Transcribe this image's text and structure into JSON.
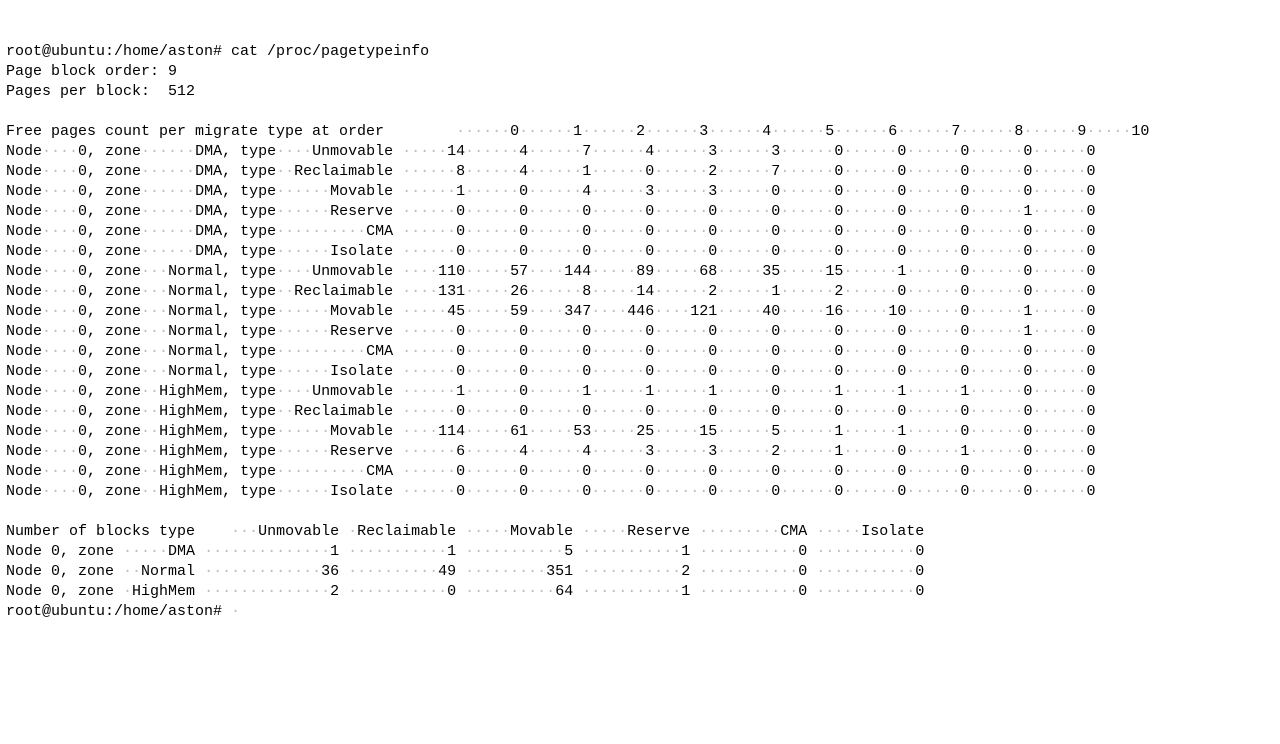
{
  "prompt": "root@ubuntu:/home/aston# ",
  "command": "cat /proc/pagetypeinfo",
  "page_block_order_label": "Page block order:",
  "page_block_order_value": 9,
  "pages_per_block_label": "Pages per block:",
  "pages_per_block_value": 512,
  "free_pages_header_label": "Free pages count per migrate type at order",
  "orders": [
    0,
    1,
    2,
    3,
    4,
    5,
    6,
    7,
    8,
    9,
    10
  ],
  "free_pages_rows": [
    {
      "node": 0,
      "zone": "DMA",
      "type": "Unmovable",
      "counts": [
        14,
        4,
        7,
        4,
        3,
        3,
        0,
        0,
        0,
        0,
        0
      ]
    },
    {
      "node": 0,
      "zone": "DMA",
      "type": "Reclaimable",
      "counts": [
        8,
        4,
        1,
        0,
        2,
        7,
        0,
        0,
        0,
        0,
        0
      ]
    },
    {
      "node": 0,
      "zone": "DMA",
      "type": "Movable",
      "counts": [
        1,
        0,
        4,
        3,
        3,
        0,
        0,
        0,
        0,
        0,
        0
      ]
    },
    {
      "node": 0,
      "zone": "DMA",
      "type": "Reserve",
      "counts": [
        0,
        0,
        0,
        0,
        0,
        0,
        0,
        0,
        0,
        1,
        0
      ]
    },
    {
      "node": 0,
      "zone": "DMA",
      "type": "CMA",
      "counts": [
        0,
        0,
        0,
        0,
        0,
        0,
        0,
        0,
        0,
        0,
        0
      ]
    },
    {
      "node": 0,
      "zone": "DMA",
      "type": "Isolate",
      "counts": [
        0,
        0,
        0,
        0,
        0,
        0,
        0,
        0,
        0,
        0,
        0
      ]
    },
    {
      "node": 0,
      "zone": "Normal",
      "type": "Unmovable",
      "counts": [
        110,
        57,
        144,
        89,
        68,
        35,
        15,
        1,
        0,
        0,
        0
      ]
    },
    {
      "node": 0,
      "zone": "Normal",
      "type": "Reclaimable",
      "counts": [
        131,
        26,
        8,
        14,
        2,
        1,
        2,
        0,
        0,
        0,
        0
      ]
    },
    {
      "node": 0,
      "zone": "Normal",
      "type": "Movable",
      "counts": [
        45,
        59,
        347,
        446,
        121,
        40,
        16,
        10,
        0,
        1,
        0
      ]
    },
    {
      "node": 0,
      "zone": "Normal",
      "type": "Reserve",
      "counts": [
        0,
        0,
        0,
        0,
        0,
        0,
        0,
        0,
        0,
        1,
        0
      ]
    },
    {
      "node": 0,
      "zone": "Normal",
      "type": "CMA",
      "counts": [
        0,
        0,
        0,
        0,
        0,
        0,
        0,
        0,
        0,
        0,
        0
      ]
    },
    {
      "node": 0,
      "zone": "Normal",
      "type": "Isolate",
      "counts": [
        0,
        0,
        0,
        0,
        0,
        0,
        0,
        0,
        0,
        0,
        0
      ]
    },
    {
      "node": 0,
      "zone": "HighMem",
      "type": "Unmovable",
      "counts": [
        1,
        0,
        1,
        1,
        1,
        0,
        1,
        1,
        1,
        0,
        0
      ]
    },
    {
      "node": 0,
      "zone": "HighMem",
      "type": "Reclaimable",
      "counts": [
        0,
        0,
        0,
        0,
        0,
        0,
        0,
        0,
        0,
        0,
        0
      ]
    },
    {
      "node": 0,
      "zone": "HighMem",
      "type": "Movable",
      "counts": [
        114,
        61,
        53,
        25,
        15,
        5,
        1,
        1,
        0,
        0,
        0
      ]
    },
    {
      "node": 0,
      "zone": "HighMem",
      "type": "Reserve",
      "counts": [
        6,
        4,
        4,
        3,
        3,
        2,
        1,
        0,
        1,
        0,
        0
      ]
    },
    {
      "node": 0,
      "zone": "HighMem",
      "type": "CMA",
      "counts": [
        0,
        0,
        0,
        0,
        0,
        0,
        0,
        0,
        0,
        0,
        0
      ]
    },
    {
      "node": 0,
      "zone": "HighMem",
      "type": "Isolate",
      "counts": [
        0,
        0,
        0,
        0,
        0,
        0,
        0,
        0,
        0,
        0,
        0
      ]
    }
  ],
  "blocks_header_label": "Number of blocks type",
  "block_types": [
    "Unmovable",
    "Reclaimable",
    "Movable",
    "Reserve",
    "CMA",
    "Isolate"
  ],
  "blocks_rows": [
    {
      "node": 0,
      "zone": "DMA",
      "counts": [
        1,
        1,
        5,
        1,
        0,
        0
      ]
    },
    {
      "node": 0,
      "zone": "Normal",
      "counts": [
        36,
        49,
        351,
        2,
        0,
        0
      ]
    },
    {
      "node": 0,
      "zone": "HighMem",
      "counts": [
        2,
        0,
        64,
        1,
        0,
        0
      ]
    }
  ],
  "chart_data": {
    "type": "table",
    "title": "/proc/pagetypeinfo",
    "tables": [
      {
        "name": "Free pages count per migrate type at order",
        "columns": [
          "Node",
          "Zone",
          "Type",
          "0",
          "1",
          "2",
          "3",
          "4",
          "5",
          "6",
          "7",
          "8",
          "9",
          "10"
        ],
        "rows": [
          [
            0,
            "DMA",
            "Unmovable",
            14,
            4,
            7,
            4,
            3,
            3,
            0,
            0,
            0,
            0,
            0
          ],
          [
            0,
            "DMA",
            "Reclaimable",
            8,
            4,
            1,
            0,
            2,
            7,
            0,
            0,
            0,
            0,
            0
          ],
          [
            0,
            "DMA",
            "Movable",
            1,
            0,
            4,
            3,
            3,
            0,
            0,
            0,
            0,
            0,
            0
          ],
          [
            0,
            "DMA",
            "Reserve",
            0,
            0,
            0,
            0,
            0,
            0,
            0,
            0,
            0,
            1,
            0
          ],
          [
            0,
            "DMA",
            "CMA",
            0,
            0,
            0,
            0,
            0,
            0,
            0,
            0,
            0,
            0,
            0
          ],
          [
            0,
            "DMA",
            "Isolate",
            0,
            0,
            0,
            0,
            0,
            0,
            0,
            0,
            0,
            0,
            0
          ],
          [
            0,
            "Normal",
            "Unmovable",
            110,
            57,
            144,
            89,
            68,
            35,
            15,
            1,
            0,
            0,
            0
          ],
          [
            0,
            "Normal",
            "Reclaimable",
            131,
            26,
            8,
            14,
            2,
            1,
            2,
            0,
            0,
            0,
            0
          ],
          [
            0,
            "Normal",
            "Movable",
            45,
            59,
            347,
            446,
            121,
            40,
            16,
            10,
            0,
            1,
            0
          ],
          [
            0,
            "Normal",
            "Reserve",
            0,
            0,
            0,
            0,
            0,
            0,
            0,
            0,
            0,
            1,
            0
          ],
          [
            0,
            "Normal",
            "CMA",
            0,
            0,
            0,
            0,
            0,
            0,
            0,
            0,
            0,
            0,
            0
          ],
          [
            0,
            "Normal",
            "Isolate",
            0,
            0,
            0,
            0,
            0,
            0,
            0,
            0,
            0,
            0,
            0
          ],
          [
            0,
            "HighMem",
            "Unmovable",
            1,
            0,
            1,
            1,
            1,
            0,
            1,
            1,
            1,
            0,
            0
          ],
          [
            0,
            "HighMem",
            "Reclaimable",
            0,
            0,
            0,
            0,
            0,
            0,
            0,
            0,
            0,
            0,
            0
          ],
          [
            0,
            "HighMem",
            "Movable",
            114,
            61,
            53,
            25,
            15,
            5,
            1,
            1,
            0,
            0,
            0
          ],
          [
            0,
            "HighMem",
            "Reserve",
            6,
            4,
            4,
            3,
            3,
            2,
            1,
            0,
            1,
            0,
            0
          ],
          [
            0,
            "HighMem",
            "CMA",
            0,
            0,
            0,
            0,
            0,
            0,
            0,
            0,
            0,
            0,
            0
          ],
          [
            0,
            "HighMem",
            "Isolate",
            0,
            0,
            0,
            0,
            0,
            0,
            0,
            0,
            0,
            0,
            0
          ]
        ]
      },
      {
        "name": "Number of blocks type",
        "columns": [
          "Node",
          "Zone",
          "Unmovable",
          "Reclaimable",
          "Movable",
          "Reserve",
          "CMA",
          "Isolate"
        ],
        "rows": [
          [
            0,
            "DMA",
            1,
            1,
            5,
            1,
            0,
            0
          ],
          [
            0,
            "Normal",
            36,
            49,
            351,
            2,
            0,
            0
          ],
          [
            0,
            "HighMem",
            2,
            0,
            64,
            1,
            0,
            0
          ]
        ]
      }
    ]
  }
}
